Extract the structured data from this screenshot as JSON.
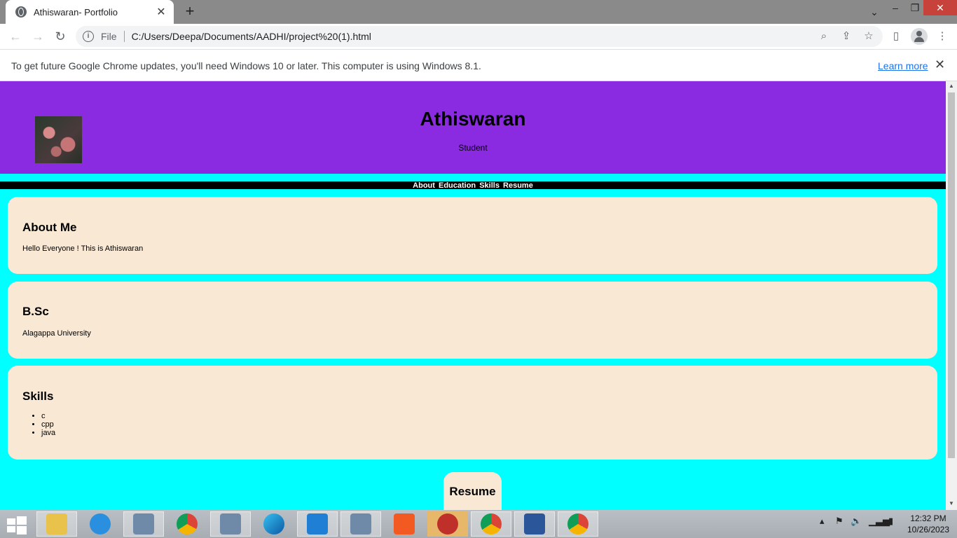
{
  "browser": {
    "tab_title": "Athiswaran- Portfolio",
    "new_tab": "+",
    "scheme_label": "File",
    "url": "C:/Users/Deepa/Documents/AADHI/project%20(1).html",
    "infobar_message": "To get future Google Chrome updates, you'll need Windows 10 or later. This computer is using Windows 8.1.",
    "infobar_link": "Learn more"
  },
  "page": {
    "name": "Athiswaran",
    "role": "Student",
    "nav": [
      "About",
      "Education",
      "Skills",
      "Resume"
    ],
    "about": {
      "title": "About Me",
      "text": "Hello Everyone ! This is Athiswaran"
    },
    "education": {
      "title": "B.Sc",
      "text": "Alagappa University"
    },
    "skills": {
      "title": "Skills",
      "items": [
        "c",
        "cpp",
        "java"
      ]
    },
    "resume": {
      "title": "Resume",
      "link": "resume"
    }
  },
  "colors": {
    "header_bg": "#8a2be2",
    "page_bg": "#00ffff",
    "card_bg": "#f8e8d4",
    "nav_bg": "#000000"
  },
  "taskbar": {
    "time": "12:32 PM",
    "date": "10/26/2023",
    "apps": [
      "file-explorer",
      "internet-explorer",
      "app-window",
      "chrome",
      "app-window",
      "edge",
      "vscode",
      "app-window",
      "brave",
      "app-red-circle",
      "chrome-profile",
      "word",
      "chrome"
    ]
  }
}
